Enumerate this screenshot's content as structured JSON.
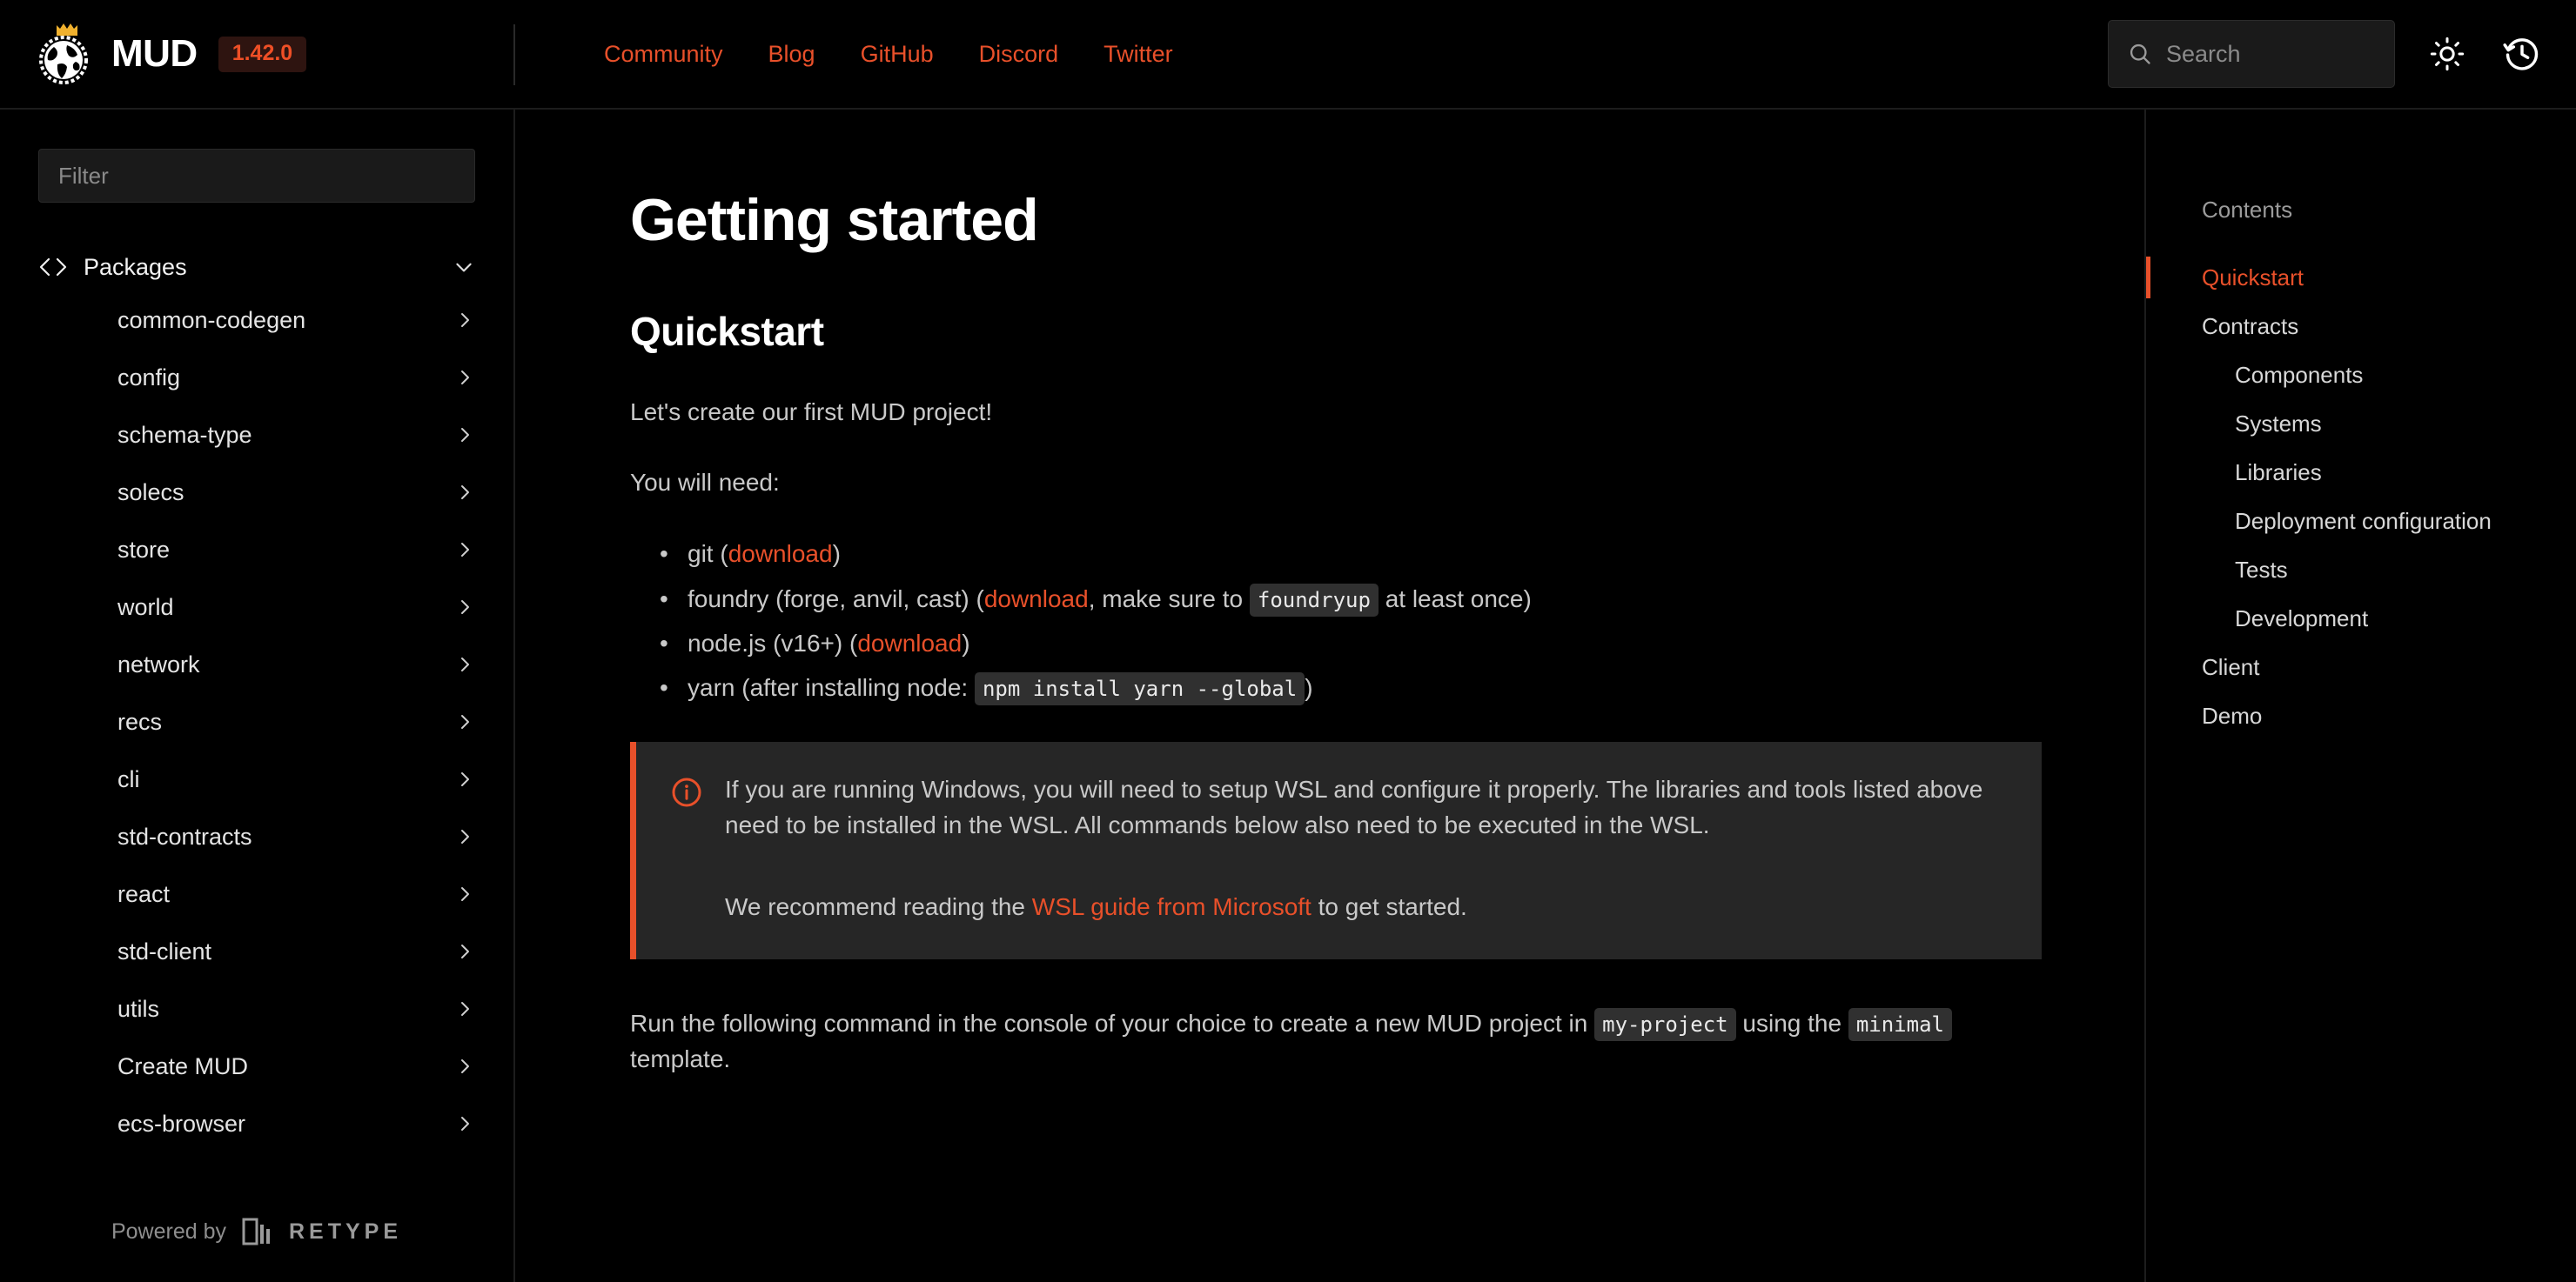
{
  "header": {
    "logo_icon": "mud-globe-crown-icon",
    "brand_name": "MUD",
    "version": "1.42.0",
    "nav": [
      {
        "label": "Community"
      },
      {
        "label": "Blog"
      },
      {
        "label": "GitHub"
      },
      {
        "label": "Discord"
      },
      {
        "label": "Twitter"
      }
    ],
    "search": {
      "placeholder": "Search",
      "value": "",
      "icon": "search-icon"
    },
    "theme_toggle_icon": "sun-icon",
    "history_icon": "history-clock-icon"
  },
  "sidebar": {
    "filter": {
      "placeholder": "Filter",
      "value": ""
    },
    "group": {
      "label": "Packages",
      "icon": "code-brackets-icon",
      "chevron": "chevron-down-icon"
    },
    "items": [
      {
        "label": "common-codegen"
      },
      {
        "label": "config"
      },
      {
        "label": "schema-type"
      },
      {
        "label": "solecs"
      },
      {
        "label": "store"
      },
      {
        "label": "world"
      },
      {
        "label": "network"
      },
      {
        "label": "recs"
      },
      {
        "label": "cli"
      },
      {
        "label": "std-contracts"
      },
      {
        "label": "react"
      },
      {
        "label": "std-client"
      },
      {
        "label": "utils"
      },
      {
        "label": "Create MUD"
      },
      {
        "label": "ecs-browser"
      }
    ],
    "footer": {
      "powered_by": "Powered by",
      "brand": "RETYPE",
      "icon": "retype-logo-icon"
    }
  },
  "main": {
    "page_title": "Getting started",
    "section_title": "Quickstart",
    "intro": "Let's create our first MUD project!",
    "needs_label": "You will need:",
    "requirements": [
      {
        "parts": [
          {
            "type": "text",
            "value": "git ("
          },
          {
            "type": "link",
            "value": "download"
          },
          {
            "type": "text",
            "value": ")"
          }
        ]
      },
      {
        "parts": [
          {
            "type": "text",
            "value": "foundry (forge, anvil, cast) ("
          },
          {
            "type": "link",
            "value": "download"
          },
          {
            "type": "text",
            "value": ", make sure to "
          },
          {
            "type": "code",
            "value": "foundryup"
          },
          {
            "type": "text",
            "value": " at least once)"
          }
        ]
      },
      {
        "parts": [
          {
            "type": "text",
            "value": "node.js (v16+) ("
          },
          {
            "type": "link",
            "value": "download"
          },
          {
            "type": "text",
            "value": ")"
          }
        ]
      },
      {
        "parts": [
          {
            "type": "text",
            "value": "yarn (after installing node: "
          },
          {
            "type": "code",
            "value": "npm install yarn --global"
          },
          {
            "type": "text",
            "value": ")"
          }
        ]
      }
    ],
    "callout": {
      "icon": "info-circle-icon",
      "accent_color": "#e8502a",
      "paragraph1": "If you are running Windows, you will need to setup WSL and configure it properly. The libraries and tools listed above need to be installed in the WSL. All commands below also need to be executed in the WSL.",
      "paragraph2_parts": [
        {
          "type": "text",
          "value": "We recommend reading the "
        },
        {
          "type": "link",
          "value": "WSL guide from Microsoft"
        },
        {
          "type": "text",
          "value": " to get started."
        }
      ]
    },
    "closing_parts": [
      {
        "type": "text",
        "value": "Run the following command in the console of your choice to create a new MUD project in "
      },
      {
        "type": "code",
        "value": "my-project"
      },
      {
        "type": "text",
        "value": " using the "
      },
      {
        "type": "code",
        "value": "minimal"
      },
      {
        "type": "text",
        "value": " template."
      }
    ]
  },
  "toc": {
    "title": "Contents",
    "items": [
      {
        "label": "Quickstart",
        "level": 1,
        "active": true
      },
      {
        "label": "Contracts",
        "level": 1,
        "active": false
      },
      {
        "label": "Components",
        "level": 2,
        "active": false
      },
      {
        "label": "Systems",
        "level": 2,
        "active": false
      },
      {
        "label": "Libraries",
        "level": 2,
        "active": false
      },
      {
        "label": "Deployment configuration",
        "level": 2,
        "active": false
      },
      {
        "label": "Tests",
        "level": 2,
        "active": false
      },
      {
        "label": "Development",
        "level": 2,
        "active": false
      },
      {
        "label": "Client",
        "level": 1,
        "active": false
      },
      {
        "label": "Demo",
        "level": 1,
        "active": false
      }
    ]
  },
  "colors": {
    "accent": "#e8502a",
    "background": "#000000",
    "code_bg": "#303030",
    "callout_bg": "#262626"
  }
}
